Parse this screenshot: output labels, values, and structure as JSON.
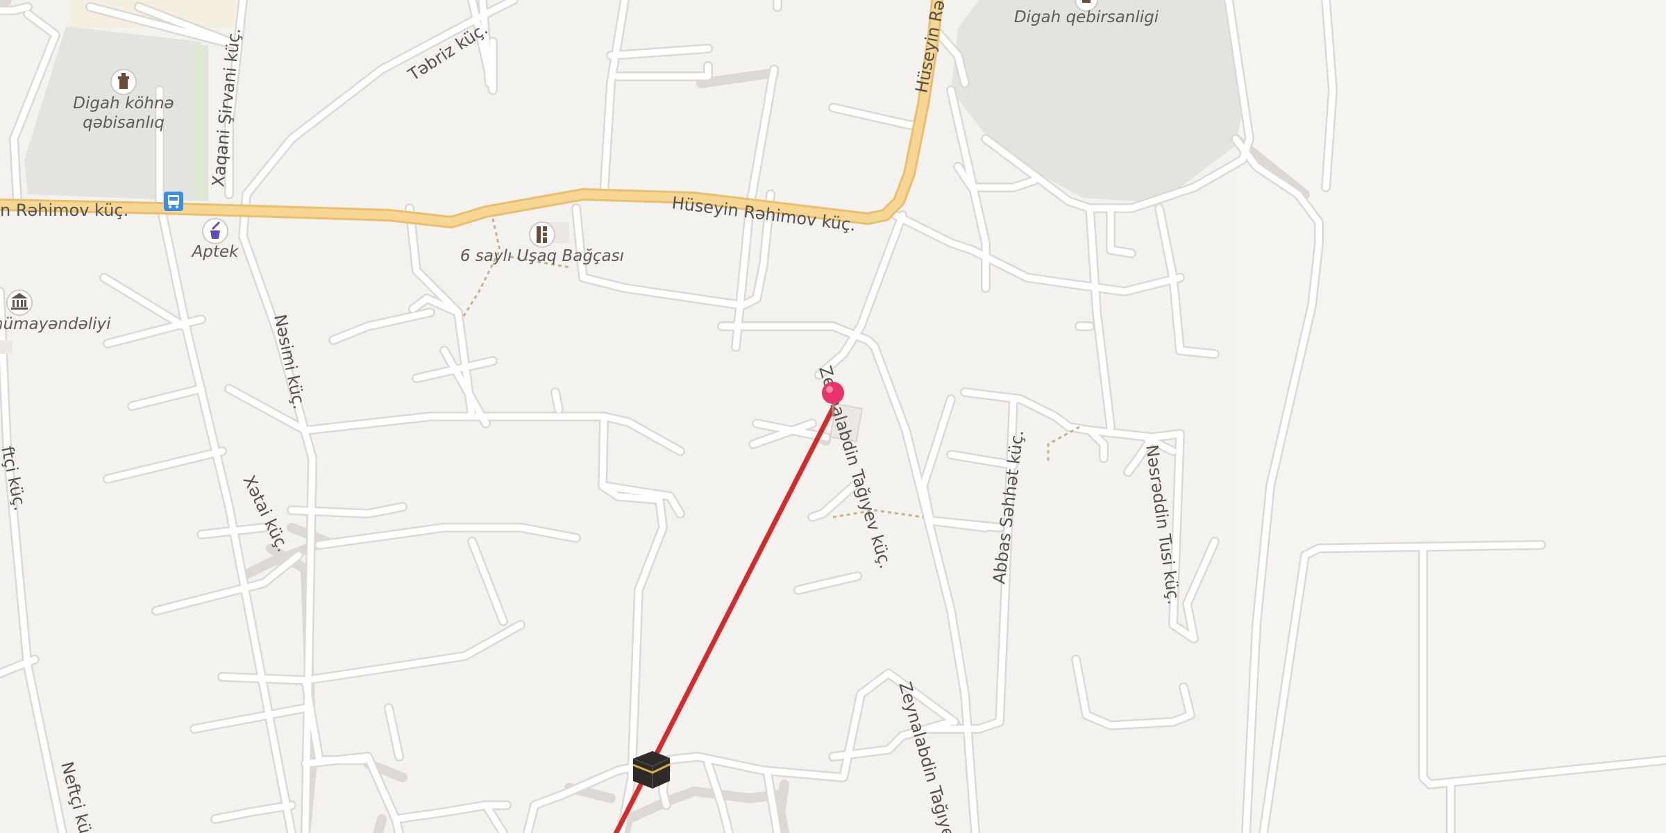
{
  "colors": {
    "background": "#f4f2ef",
    "park": "#e3e4df",
    "road_minor": "#ffffff",
    "road_casing": "#dcd8d3",
    "road_major": "#f7d592",
    "road_major_casing": "#e8be6f",
    "route_line": "#d42a2a",
    "pin": "#e8336b",
    "footpath": "#c8ae8e"
  },
  "streets": {
    "huseyn_rehimov_main": "Hüseyin Rəhimov küç.",
    "huseyn_rehimov_left": "n Rəhimov küç.",
    "huseyn_rehimov_north": "Hüseyin Rə",
    "tebriz": "Təbriz küç.",
    "xaqani_sirvani": "Xaqani Şirvani küç.",
    "nesimi": "Nəsimi küç.",
    "xetai": "Xətai küç.",
    "neftci": "Neftçi kü",
    "zeynalabdin_north": "Zeynalabdin Tağıyev küç.",
    "zeynalabdin_south": "Zeynalabdin Tağıye",
    "abbas_sehhet": "Abbas Səhhət küç.",
    "nesreddin_tusi": "Nəsrəddin Tusi küç.",
    "left_edge_vertical": "ftçi küç."
  },
  "pois": {
    "old_cemetery_line1": "Digah köhnə",
    "old_cemetery_line2": "qəbisanlıq",
    "digah_cemetery": "Digah qebirsanligi",
    "pharmacy": "Aptek",
    "kindergarten": "6 saylı Uşaq Bağçası",
    "representation": "nümayəndəliyi"
  },
  "icons": {
    "cemetery": "cemetery-icon",
    "bus_stop": "bus-stop-icon",
    "pharmacy": "pharmacy-icon",
    "kindergarten": "kindergarten-icon",
    "government": "government-building-icon",
    "mosque": "kaaba-icon",
    "pin": "location-pin-icon"
  }
}
